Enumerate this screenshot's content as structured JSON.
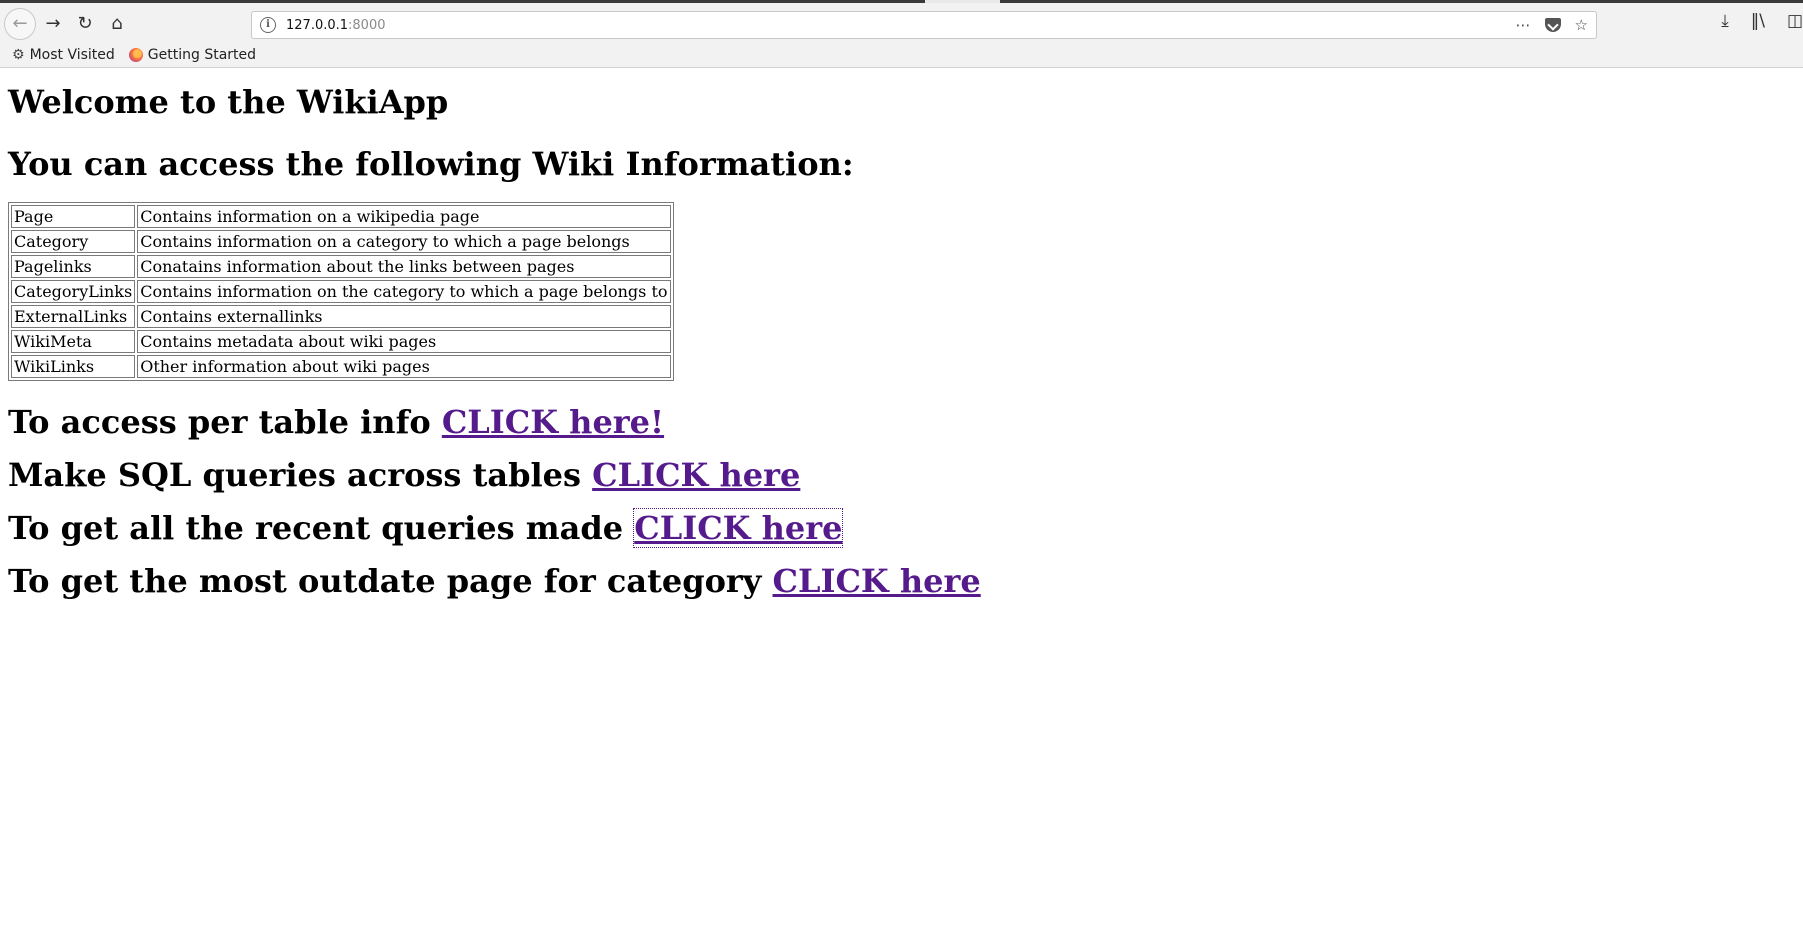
{
  "browser": {
    "url_host": "127.0.0.1",
    "url_port": ":8000",
    "bookmarks": [
      {
        "label": "Most Visited",
        "icon": "gear-icon"
      },
      {
        "label": "Getting Started",
        "icon": "firefox-icon"
      }
    ]
  },
  "page": {
    "title": "Welcome to the WikiApp",
    "subtitle": "You can access the following Wiki Information:",
    "table": [
      {
        "name": "Page",
        "description": "Contains information on a wikipedia page"
      },
      {
        "name": "Category",
        "description": "Contains information on a category to which a page belongs"
      },
      {
        "name": "Pagelinks",
        "description": "Conatains information about the links between pages"
      },
      {
        "name": "CategoryLinks",
        "description": "Contains information on the category to which a page belongs to"
      },
      {
        "name": "ExternalLinks",
        "description": "Contains externallinks"
      },
      {
        "name": "WikiMeta",
        "description": "Contains metadata about wiki pages"
      },
      {
        "name": "WikiLinks",
        "description": "Other information about wiki pages"
      }
    ],
    "links": [
      {
        "text": "To access per table info ",
        "link_label": "CLICK here!"
      },
      {
        "text": "Make SQL queries across tables ",
        "link_label": "CLICK here"
      },
      {
        "text": "To get all the recent queries made ",
        "link_label": "CLICK here"
      },
      {
        "text": "To get the most outdate page for category ",
        "link_label": "CLICK here"
      }
    ]
  },
  "colors": {
    "visited_link": "#551a8b"
  }
}
